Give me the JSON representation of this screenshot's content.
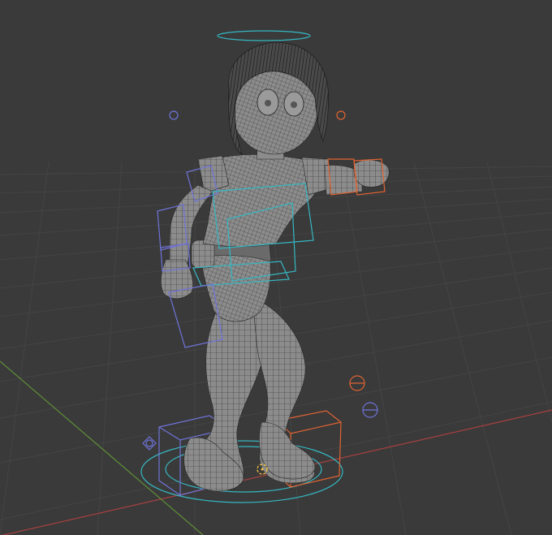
{
  "viewport": {
    "background_color": "#3a3a3a",
    "grid_color": "#444444",
    "x_axis_color": "#b24444",
    "y_axis_color": "#6a9a3a"
  },
  "model": {
    "mesh_color": "#8c8c8c",
    "wire_color": "#262626"
  },
  "rig": {
    "control_colors": {
      "center": "#35b7c2",
      "left": "#6f73d8",
      "right": "#e06432"
    }
  }
}
